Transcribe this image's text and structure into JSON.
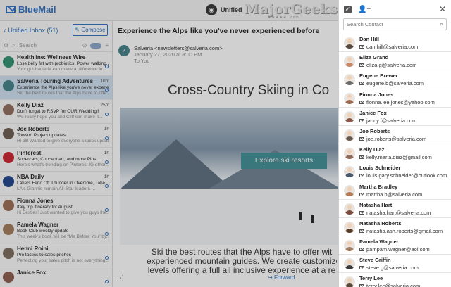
{
  "app": {
    "name": "BlueMail",
    "unified_label": "Unified",
    "watermark": "MajorGeeks",
    "watermark_stars": "★★★★★ .com"
  },
  "mail_list": {
    "folder_label": "Unified Inbox (51)",
    "compose_label": "Compose",
    "search_placeholder": "Search",
    "messages": [
      {
        "from": "Healthline: Wellness Wire",
        "subject": "Lose belly fat with probiotics. Power walking...",
        "preview": "Your gut bacteria can make a difference in...",
        "time": "",
        "avatar_color": "#2f8f6f"
      },
      {
        "from": "Salveria Touring Adventures",
        "subject": "Experience the Alps like you've never experie...",
        "preview": "Ski the best routes that the Alps have to offe...",
        "time": "10m",
        "avatar_color": "#3f7f87"
      },
      {
        "from": "Kelly Diaz",
        "subject": "Don't forget to RSVP for OUR Wedding!!",
        "preview": "We really hope you and Cliff can make it...",
        "time": "25m",
        "avatar_color": "#8e6b5a"
      },
      {
        "from": "Joe Roberts",
        "subject": "Towson Project updates",
        "preview": "Hi all! Wanted to give everyone a quick updat...",
        "time": "1h",
        "avatar_color": "#6b5a4e"
      },
      {
        "from": "Pinterest",
        "subject": "Supercars, Concept art, and more Pins...",
        "preview": "Here's what's trending on Pinterest IG other...",
        "time": "1h",
        "avatar_color": "#c8232c"
      },
      {
        "from": "NBA Daily",
        "subject": "Lakers Fend Off Thunder In Overtime, Take...",
        "preview": "LA's Giannis remain All-Star leaders ...",
        "time": "1h",
        "avatar_color": "#1d428a"
      },
      {
        "from": "Fionna Jones",
        "subject": "Italy trip itinerary for August",
        "preview": "Hi Besties! Just wanted to give you guys the...",
        "time": "",
        "avatar_color": "#9a6b52"
      },
      {
        "from": "Pamela Wagner",
        "subject": "Book Club weekly update",
        "preview": "This week's book will be \"Me Before You\" by...",
        "time": "",
        "avatar_color": "#a07a5a"
      },
      {
        "from": "Henni Roini",
        "subject": "Pro tactics to sales pitches",
        "preview": "Perfecting your sales pitch is not everything...",
        "time": "",
        "avatar_color": "#7a6a5a"
      },
      {
        "from": "Janice Fox",
        "subject": "",
        "preview": "",
        "time": "",
        "avatar_color": "#8a5a4a"
      }
    ]
  },
  "reading_pane": {
    "subject": "Experience the Alps like you've never experienced before",
    "sender_name": "Salveria <newsletters@salveria.com>",
    "date": "January 27, 2020 at 8:00 PM",
    "to": "To You",
    "headline": "Cross-Country Skiing in Co",
    "cta_label": "Explore ski resorts",
    "body_line1": "Ski the best routes that the Alps have to offer wit",
    "body_line2": "experienced mountain guides. We create customize",
    "body_line3": "levels offering a full all inclusive experience at a re",
    "forward_label": "Forward"
  },
  "contacts_panel": {
    "search_placeholder": "Search Contact",
    "contacts": [
      {
        "name": "Dan Hill",
        "email": "dan.hill@salveria.com",
        "color": "#5a4a3e"
      },
      {
        "name": "Eliza Grand",
        "email": "eliza.g@salveria.com",
        "color": "#c98a6a"
      },
      {
        "name": "Eugene Brewer",
        "email": "eugene.b@salveria.com",
        "color": "#6a6a6a"
      },
      {
        "name": "Fionna Jones",
        "email": "fionna.lee.jones@yahoo.com",
        "color": "#9a6b52"
      },
      {
        "name": "Janice Fox",
        "email": "janny.f@salveria.com",
        "color": "#8a5a4a"
      },
      {
        "name": "Joe Roberts",
        "email": "joe.roberts@salveria.com",
        "color": "#6b5a4e"
      },
      {
        "name": "Kelly Diaz",
        "email": "kelly.maria.diaz@gmail.com",
        "color": "#8e6b5a"
      },
      {
        "name": "Louis Schneider",
        "email": "louis.gary.schneider@outlook.com",
        "color": "#4a5a6a"
      },
      {
        "name": "Martha Bradley",
        "email": "martha.b@salveria.com",
        "color": "#b07a5a"
      },
      {
        "name": "Natasha Hart",
        "email": "natasha.hart@salveria.com",
        "color": "#7a4a3a"
      },
      {
        "name": "Natasha Roberts",
        "email": "natasha.ash.roberts@gmail.com",
        "color": "#5a3a2a"
      },
      {
        "name": "Pamela Wagner",
        "email": "pampam.wagner@aol.com",
        "color": "#a07a5a"
      },
      {
        "name": "Steve Griffin",
        "email": "steve.g@salveria.com",
        "color": "#3a3a3a"
      },
      {
        "name": "Terry Lee",
        "email": "terry.lee@salveria.com",
        "color": "#5a4a3a"
      }
    ]
  }
}
